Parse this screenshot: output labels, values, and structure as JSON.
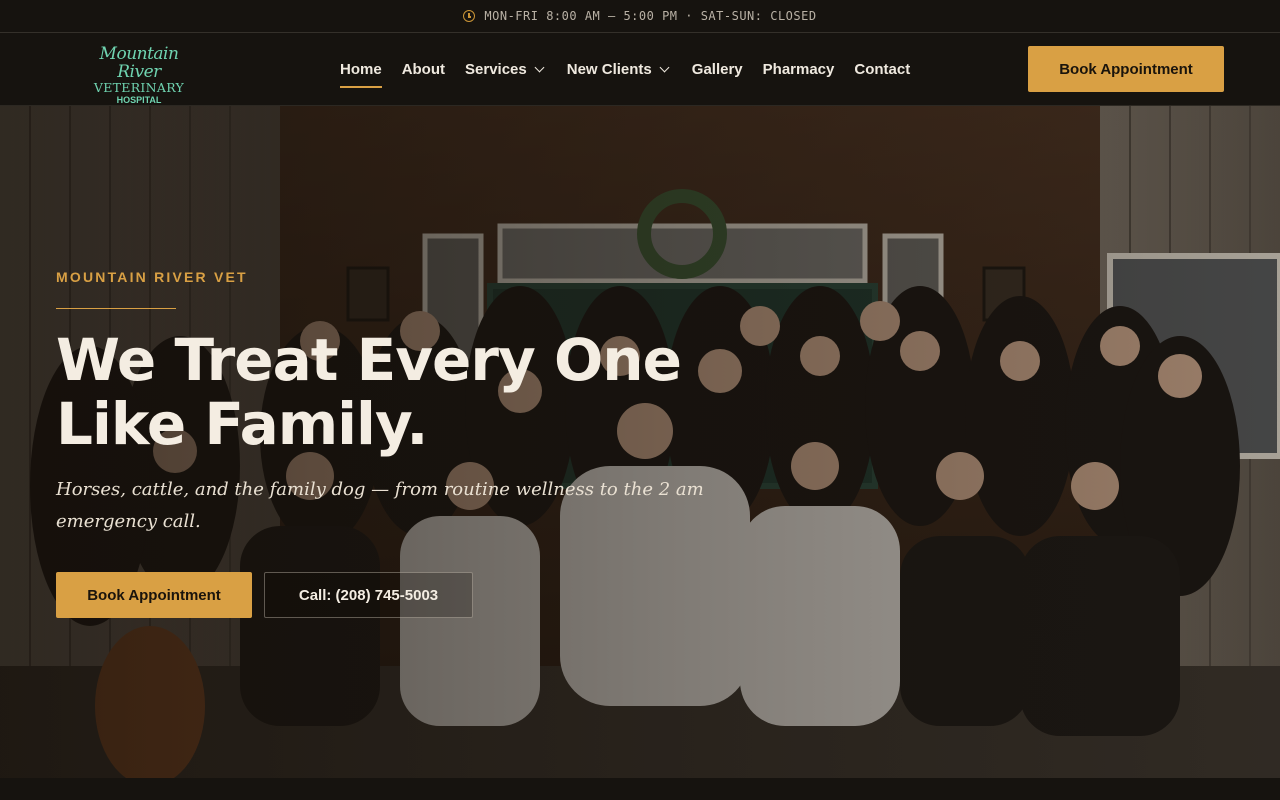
{
  "topbar": {
    "clock_icon": "clock-icon",
    "hours": "MON-FRI 8:00 AM – 5:00 PM · SAT-SUN: CLOSED"
  },
  "logo": {
    "line1": "Mountain River",
    "line2": "VETERINARY",
    "line3": "HOSPITAL"
  },
  "nav": {
    "items": [
      {
        "label": "Home",
        "active": true
      },
      {
        "label": "About"
      },
      {
        "label": "Services",
        "has_dropdown": true
      },
      {
        "label": "New Clients",
        "has_dropdown": true
      },
      {
        "label": "Gallery"
      },
      {
        "label": "Pharmacy"
      },
      {
        "label": "Contact"
      }
    ],
    "cta": "Book Appointment"
  },
  "hero": {
    "eyebrow": "MOUNTAIN RIVER VET",
    "headline": "We Treat Every One Like Family.",
    "subline": "Horses, cattle, and the family dog — from routine wellness to the 2 am emergency call.",
    "primary_button": "Book Appointment",
    "secondary_button": "Call: (208) 745-5003"
  },
  "colors": {
    "accent": "#d9a044",
    "background": "#16130f",
    "logo_green": "#6fd3b0",
    "text_light": "#f4ede2"
  }
}
